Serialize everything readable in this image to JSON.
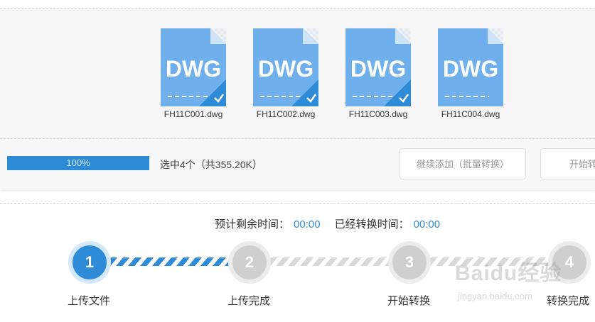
{
  "files": [
    {
      "name": "FH11C001.dwg",
      "icon": "dwg-file-icon",
      "label": "DWG",
      "selected": true
    },
    {
      "name": "FH11C002.dwg",
      "icon": "dwg-file-icon",
      "label": "DWG",
      "selected": true
    },
    {
      "name": "FH11C003.dwg",
      "icon": "dwg-file-icon",
      "label": "DWG",
      "selected": true
    },
    {
      "name": "FH11C004.dwg",
      "icon": "dwg-file-icon",
      "label": "DWG",
      "selected": false
    }
  ],
  "upload": {
    "progress_text": "100%",
    "progress_fraction": 1.0,
    "selected_summary": "选中4个（共355.20K）"
  },
  "buttons": {
    "continue_label": "继续添加（批量转换）",
    "start_label": "开始转换"
  },
  "timing": {
    "remaining_label": "预计剩余时间：",
    "remaining_value": "00:00",
    "elapsed_label": "已经转换时间：",
    "elapsed_value": "00:00"
  },
  "steps": [
    {
      "number": "1",
      "label": "上传文件",
      "state": "active"
    },
    {
      "number": "2",
      "label": "上传完成",
      "state": "pending"
    },
    {
      "number": "3",
      "label": "开始转换",
      "state": "pending"
    },
    {
      "number": "4",
      "label": "转换完成",
      "state": "pending"
    }
  ],
  "watermark": {
    "logo": "Baidu经验",
    "url": "jingyan.baidu.com"
  },
  "colors": {
    "accent": "#2e8bd8",
    "file_icon": "#6fb0ec",
    "pending_step": "#cfcfcf"
  }
}
